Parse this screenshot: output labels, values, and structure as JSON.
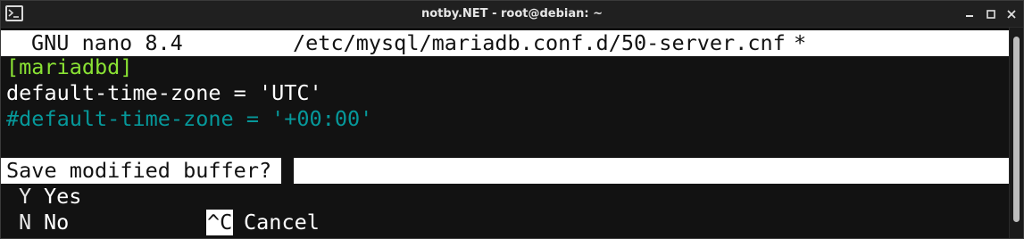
{
  "window": {
    "title": "notby.NET - root@debian: ~"
  },
  "nano": {
    "version_label": "GNU nano 8.4",
    "file_path": "/etc/mysql/mariadb.conf.d/50-server.cnf",
    "modified_marker": "*"
  },
  "editor_lines": [
    "[mariadbd]",
    "default-time-zone = 'UTC'",
    "#default-time-zone = '+00:00'"
  ],
  "prompt": {
    "question": "Save modified buffer?"
  },
  "options": {
    "yes_key": "Y",
    "yes_label": "Yes",
    "no_key": "N",
    "no_label": "No",
    "cancel_key": "^C",
    "cancel_label": "Cancel"
  },
  "colors": {
    "section_header": "#8ae234",
    "comment": "#06989a",
    "background": "#121212",
    "foreground": "#ffffff"
  }
}
